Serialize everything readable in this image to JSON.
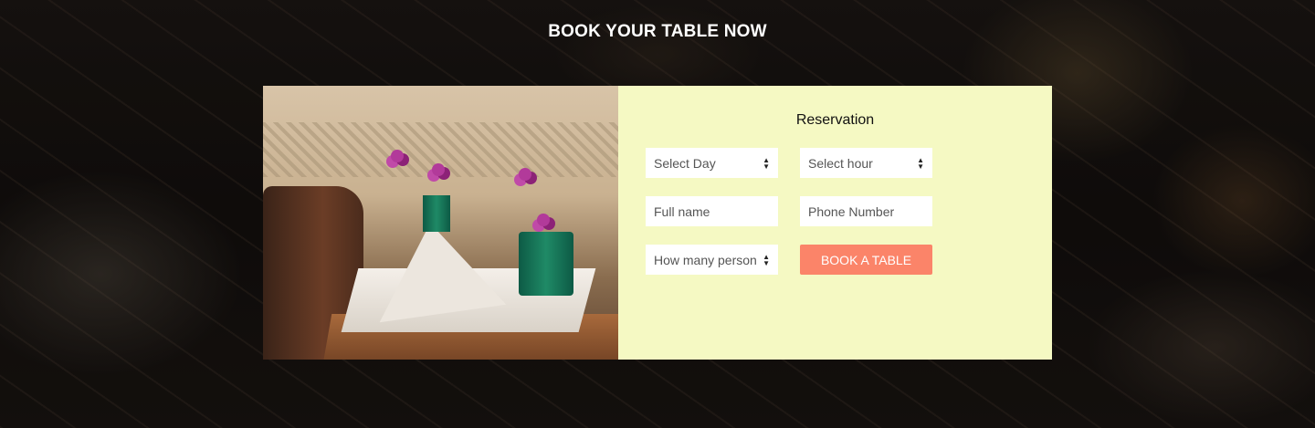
{
  "section": {
    "title": "BOOK YOUR TABLE NOW"
  },
  "reservation": {
    "title": "Reservation",
    "day_select": "Select Day",
    "hour_select": "Select hour",
    "name_placeholder": "Full name",
    "phone_placeholder": "Phone Number",
    "persons_select": "How many person's",
    "submit_label": "BOOK A TABLE"
  },
  "colors": {
    "form_bg": "#f5f9c3",
    "button": "#fb8469"
  },
  "images": {
    "photo": "restaurant-table-setting-photo",
    "background": "restaurant-overhead-background"
  }
}
